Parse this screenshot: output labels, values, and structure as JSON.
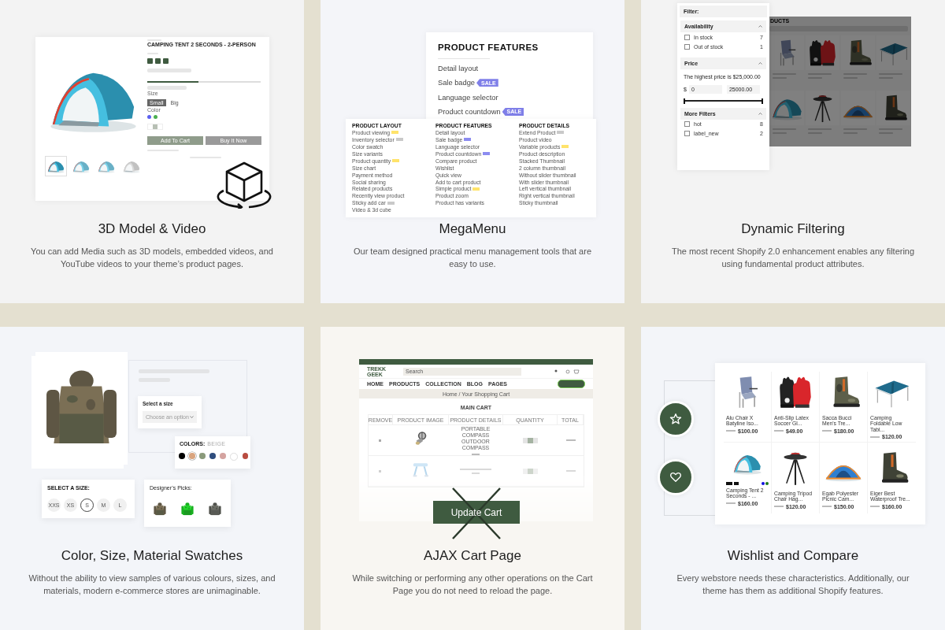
{
  "features": [
    {
      "kind": "model3d",
      "title": "3D Model & Video",
      "description": "You can add Media such as 3D models, embedded videos, and YouTube videos to your theme’s product pages.",
      "mockup": {
        "product_title": "CAMPING TENT 2 SECONDS - 2-PERSON",
        "stock": {
          "level": 0.45
        },
        "size_label": "Size",
        "sizes": [
          {
            "label": "Small",
            "selected": true
          },
          {
            "label": "Big",
            "selected": false
          }
        ],
        "color_label": "Color",
        "colors": [
          {
            "color": "#5b5ff0"
          },
          {
            "color": "#4caf50"
          }
        ],
        "buttons": [
          "Add To Cart",
          "Buy It Now"
        ]
      }
    },
    {
      "kind": "megamenu",
      "title": "MegaMenu",
      "description": "Our team designed practical menu management tools that are easy to use.",
      "mockup": {
        "heading": "PRODUCT FEATURES",
        "items": [
          {
            "label": "Detail layout"
          },
          {
            "label": "Sale badge",
            "badge": "SALE"
          },
          {
            "label": "Language selector"
          },
          {
            "label": "Product countdown",
            "badge": "SALE"
          }
        ],
        "columns": [
          {
            "heading": "PRODUCT LAYOUT",
            "items": [
              {
                "label": "Product viewing",
                "color": "#ffe36b"
              },
              {
                "label": "Inventory selector",
                "color": "#c9c9c9"
              },
              {
                "label": "Color swatch"
              },
              {
                "label": "Size variants"
              },
              {
                "label": "Product quantity",
                "color": "#ffe36b"
              },
              {
                "label": "Size chart"
              },
              {
                "label": "Payment method"
              },
              {
                "label": "Social sharing"
              },
              {
                "label": "Related products"
              },
              {
                "label": "Recently view product"
              },
              {
                "label": "Sticky add car",
                "color": "#c9c9c9"
              },
              {
                "label": "Video & 3d cube"
              }
            ]
          },
          {
            "heading": "PRODUCT FEATURES",
            "items": [
              {
                "label": "Detail layout"
              },
              {
                "label": "Sale badge",
                "color": "#8c8cf0"
              },
              {
                "label": "Language selector"
              },
              {
                "label": "Product countdown",
                "color": "#8c8cf0"
              },
              {
                "label": "Compare product"
              },
              {
                "label": "Wishlist"
              },
              {
                "label": "Quick view"
              },
              {
                "label": "Add to cart product"
              },
              {
                "label": "Simple product",
                "color": "#ffe36b"
              },
              {
                "label": "Product zoom"
              },
              {
                "label": "Product has variants"
              }
            ]
          },
          {
            "heading": "PRODUCT DETAILS",
            "items": [
              {
                "label": "Extend Product",
                "color": "#c9c9c9"
              },
              {
                "label": "Product video"
              },
              {
                "label": "Variable products",
                "color": "#ffe36b"
              },
              {
                "label": "Product description"
              },
              {
                "label": "Stacked Thumbnail"
              },
              {
                "label": "2 column thumbnail"
              },
              {
                "label": "Without slider thumbnail"
              },
              {
                "label": "With slider thumbnail"
              },
              {
                "label": "Left vertical thumbnail"
              },
              {
                "label": "Right vertical thumbnail"
              },
              {
                "label": "Sticky thumbnail"
              }
            ]
          }
        ]
      }
    },
    {
      "kind": "filter",
      "title": "Dynamic Filtering",
      "description": "The most recent Shopify 2.0 enhancement enables any filtering using fundamental product attributes.",
      "mockup": {
        "heading": "Filter:",
        "groups": [
          {
            "kind": "options",
            "title": "Availability",
            "expanded": true,
            "options": [
              {
                "label": "In stock",
                "count": "7",
                "checked": false
              },
              {
                "label": "Out of stock",
                "count": "1",
                "checked": false
              }
            ]
          },
          {
            "kind": "price",
            "title": "Price",
            "expanded": true,
            "note": "The highest price is $25,000.00",
            "currency": "$",
            "min": "0",
            "max": "25000.00",
            "thumbs": [
              {
                "level": 0
              },
              {
                "level": 1
              }
            ]
          },
          {
            "kind": "options",
            "title": "More Filters",
            "expanded": true,
            "options": [
              {
                "label": "hot",
                "count": "8",
                "checked": false
              },
              {
                "label": "label_new",
                "count": "2",
                "checked": false
              }
            ]
          }
        ],
        "grid_heading": "DUCTS"
      }
    },
    {
      "kind": "swatches",
      "title": "Color, Size, Material Swatches",
      "description": "Without the ability to view samples of various colours, sizes, and materials, modern e-commerce stores are unimaginable.",
      "mockup": {
        "select_label": "Select a size",
        "select_placeholder": "Choose an option",
        "colors_label": "COLORS:",
        "color_name": "BEIGE",
        "colors": [
          {
            "color": "#000000",
            "selected": false
          },
          {
            "color": "#d9a47e",
            "selected": true
          },
          {
            "color": "#8a9a7b",
            "selected": false
          },
          {
            "color": "#2f4d7e",
            "selected": false
          },
          {
            "color": "#d4a3a0",
            "selected": false
          },
          {
            "color": "#ffffff",
            "selected": false
          },
          {
            "color": "#b94c40",
            "selected": false
          }
        ],
        "size_label": "SELECT A SIZE:",
        "sizes": [
          {
            "label": "XXS",
            "selected": false
          },
          {
            "label": "XS",
            "selected": false
          },
          {
            "label": "S",
            "selected": true
          },
          {
            "label": "M",
            "selected": false
          },
          {
            "label": "L",
            "selected": false
          }
        ],
        "picks_label": "Designer’s Picks:"
      }
    },
    {
      "kind": "cart",
      "title": "AJAX Cart Page",
      "description": "While switching or performing any other operations on the Cart Page you do not need to reload the page.",
      "mockup": {
        "logo": "TREKK GEEK",
        "search_placeholder": "Search",
        "nav": [
          "HOME",
          "PRODUCTS",
          "COLLECTION",
          "BLOG",
          "PAGES"
        ],
        "breadcrumb": "Home / Your Shopping Cart",
        "heading": "MAIN CART",
        "columns": [
          "REMOVE",
          "PRODUCT IMAGE",
          "PRODUCT DETAILS",
          "QUANTITY",
          "TOTAL"
        ],
        "rows": [
          {
            "name": "PORTABLE COMPASS OUTDOOR COMPASS",
            "faded": false
          },
          {
            "faded": true
          }
        ],
        "button": "Update Cart",
        "crossed_out": true
      }
    },
    {
      "kind": "wishlist",
      "title": "Wishlist and Compare",
      "description": "Every webstore needs these characteristics. Additionally, our theme has them as additional Shopify features.",
      "mockup": {
        "products": [
          {
            "name": "Alu Chair X Batyline Iso...",
            "price": "$100.00"
          },
          {
            "name": "Anti-Slip Latex Soccer Gl...",
            "price": "$49.00"
          },
          {
            "name": "Sacca Bucci Men's Tre...",
            "price": "$180.00"
          },
          {
            "name": "Camping Foldable Low Tabl...",
            "price": "$120.00"
          },
          {
            "name": "Camping Tent 2 Seconds - ...",
            "price": "$160.00",
            "colors": [
              {
                "color": "#1010e0"
              },
              {
                "color": "#1a7a1a"
              }
            ]
          },
          {
            "name": "Camping Tripod Chair Hag...",
            "price": "$120.00"
          },
          {
            "name": "Egab Polyester Picnic Cam...",
            "price": "$150.00"
          },
          {
            "name": "Eiger Best Waterproof Tre...",
            "price": "$160.00"
          }
        ]
      }
    }
  ]
}
